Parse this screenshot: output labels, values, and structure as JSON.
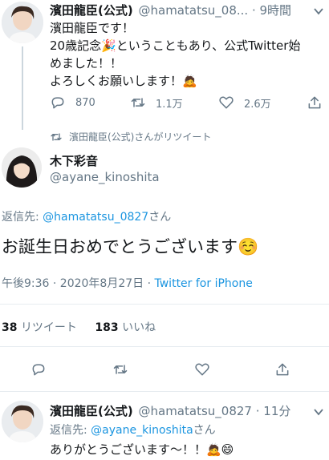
{
  "tweet1": {
    "name": "濱田龍臣(公式)",
    "handle": "@hamatatsu_08...",
    "dot": "·",
    "time": "9時間",
    "line1": "濱田龍臣です！",
    "line2": "20歳記念🎉ということもあり、公式Twitter始",
    "line3": "めました！！",
    "line4": "よろしくお願いします！🙇",
    "reply_count": "870",
    "retweet_count": "1.1万",
    "like_count": "2.6万"
  },
  "retweet_label": "濱田龍臣(公式)さんがリツイート",
  "tweet2": {
    "name": "木下彩音",
    "handle": "@ayane_kinoshita",
    "reply_prefix": "返信先: ",
    "reply_to": "@hamatatsu_0827",
    "reply_suffix": "さん",
    "text": "お誕生日おめでとうございます☺️",
    "timestamp": "午後9:36 · 2020年8月27日 · ",
    "client": "Twitter for iPhone",
    "retweets_num": "38",
    "retweets_label": "リツイート",
    "likes_num": "183",
    "likes_label": "いいね"
  },
  "tweet3": {
    "name": "濱田龍臣(公式)",
    "handle": "@hamatatsu_0827",
    "dot": "·",
    "time": "11分",
    "reply_prefix": "返信先: ",
    "reply_to": "@ayane_kinoshita",
    "reply_suffix": "さん",
    "text": "ありがとうございます〜！！🙇😄"
  },
  "colors": {
    "link": "#1b95e0",
    "muted": "#657786",
    "divider": "#e6ecf0"
  },
  "icons": [
    "reply-icon",
    "retweet-icon",
    "like-icon",
    "share-icon",
    "more-chevron-icon"
  ]
}
